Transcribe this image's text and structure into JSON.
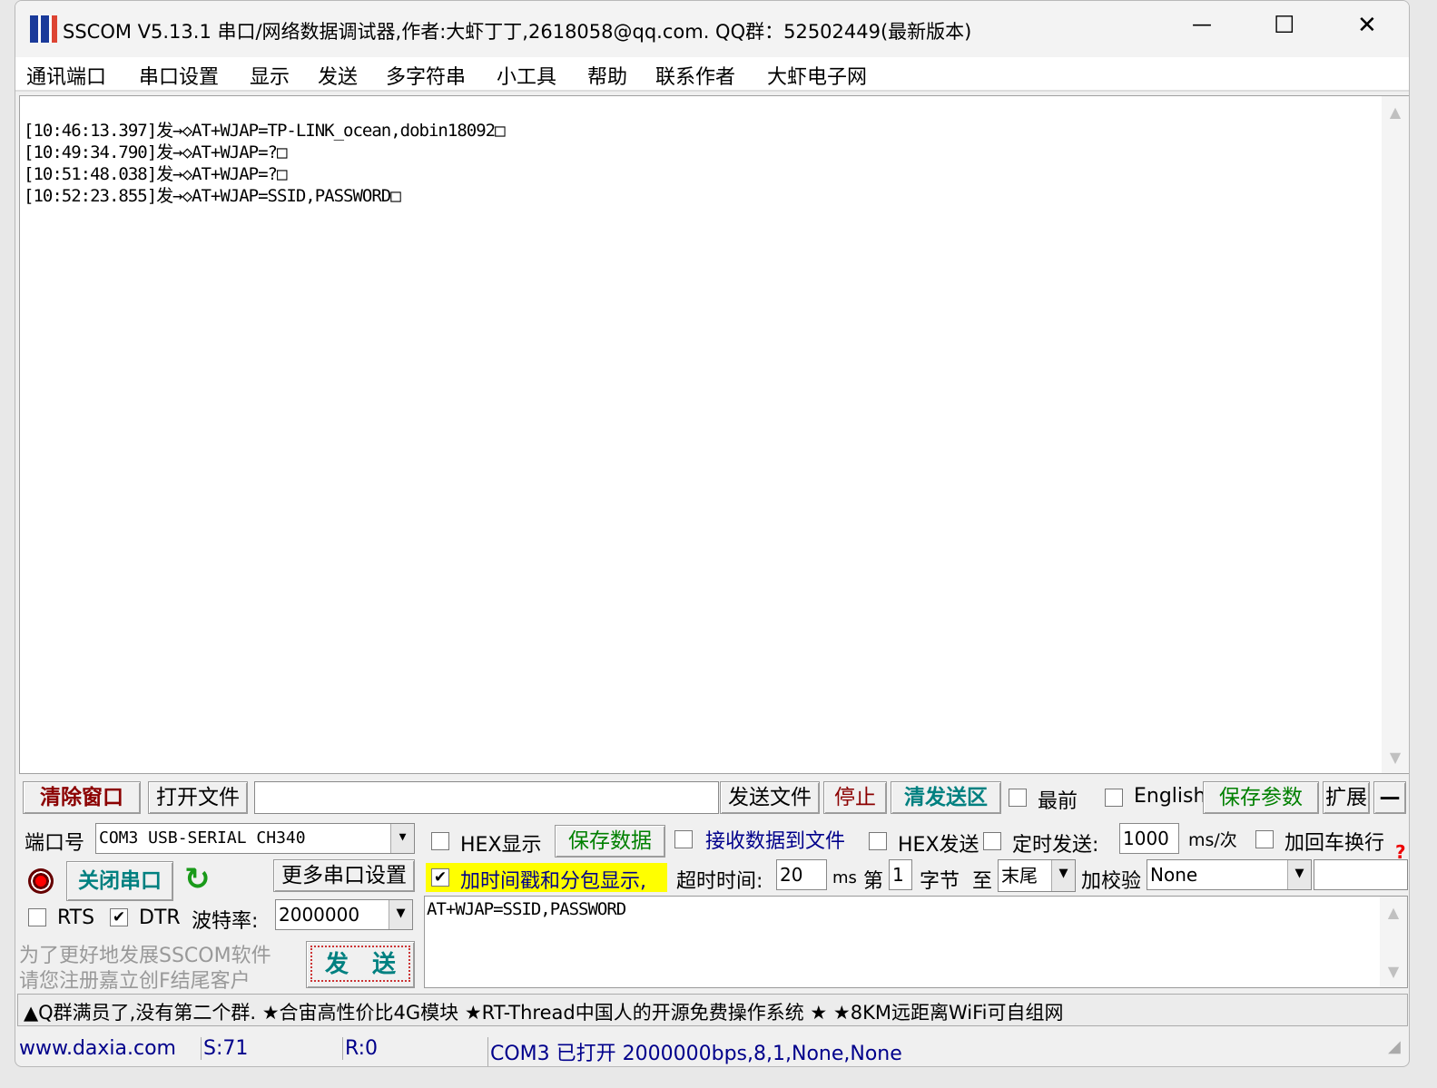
{
  "window": {
    "title": "SSCOM V5.13.1 串口/网络数据调试器,作者:大虾丁丁,2618058@qq.com. QQ群：52502449(最新版本)",
    "minimize": "—",
    "maximize": "☐",
    "close": "✕"
  },
  "menu": [
    "通讯端口",
    "串口设置",
    "显示",
    "发送",
    "多字符串",
    "小工具",
    "帮助",
    "联系作者",
    "大虾电子网"
  ],
  "receive_log": [
    "[10:46:13.397]发→◇AT+WJAP=TP-LINK_ocean,dobin18092□",
    "[10:49:34.790]发→◇AT+WJAP=?□",
    "[10:51:48.038]发→◇AT+WJAP=?□",
    "[10:52:23.855]发→◇AT+WJAP=SSID,PASSWORD□"
  ],
  "toolbar": {
    "clear": "清除窗口",
    "open_file": "打开文件",
    "file_path": "",
    "send_file": "发送文件",
    "stop": "停止",
    "clear_send": "清发送区",
    "topmost": "最前",
    "english": "English",
    "save_params": "保存参数",
    "expand": "扩展",
    "collapse": "—"
  },
  "port": {
    "label": "端口号",
    "value": "COM3 USB-SERIAL CH340",
    "close_port": "关闭串口",
    "more_settings": "更多串口设置",
    "rts": "RTS",
    "dtr": "DTR",
    "baud_label": "波特率:",
    "baud": "2000000"
  },
  "promo": [
    "为了更好地发展SSCOM软件",
    "请您注册嘉立创F结尾客户"
  ],
  "send_button": "发　送",
  "options": {
    "hex_display": "HEX显示",
    "save_data": "保存数据",
    "recv_to_file": "接收数据到文件",
    "hex_send": "HEX发送",
    "timed_send": "定时发送:",
    "interval": "1000",
    "interval_unit": "ms/次",
    "add_crlf": "加回车换行",
    "timestamp": "加时间戳和分包显示,",
    "timeout_label": "超时时间:",
    "timeout": "20",
    "timeout_unit": "ms",
    "from_label": "第",
    "from": "1",
    "byte_label": "字节",
    "to_label": "至",
    "to": "末尾",
    "checksum_label": "加校验",
    "checksum": "None",
    "help": "?"
  },
  "checks": {
    "rts": false,
    "dtr": true,
    "hex_display": false,
    "recv_to_file": false,
    "hex_send": false,
    "timed_send": false,
    "add_crlf": false,
    "timestamp": true,
    "topmost": false,
    "english": false
  },
  "send_text": "AT+WJAP=SSID,PASSWORD",
  "ticker": "▲Q群满员了,没有第二个群. ★合宙高性价比4G模块 ★RT-Thread中国人的开源免费操作系统 ★ ★8KM远距离WiFi可自组网",
  "status": {
    "website": "www.daxia.com",
    "sent": "S:71",
    "received": "R:0",
    "port_status": "COM3 已打开  2000000bps,8,1,None,None"
  }
}
